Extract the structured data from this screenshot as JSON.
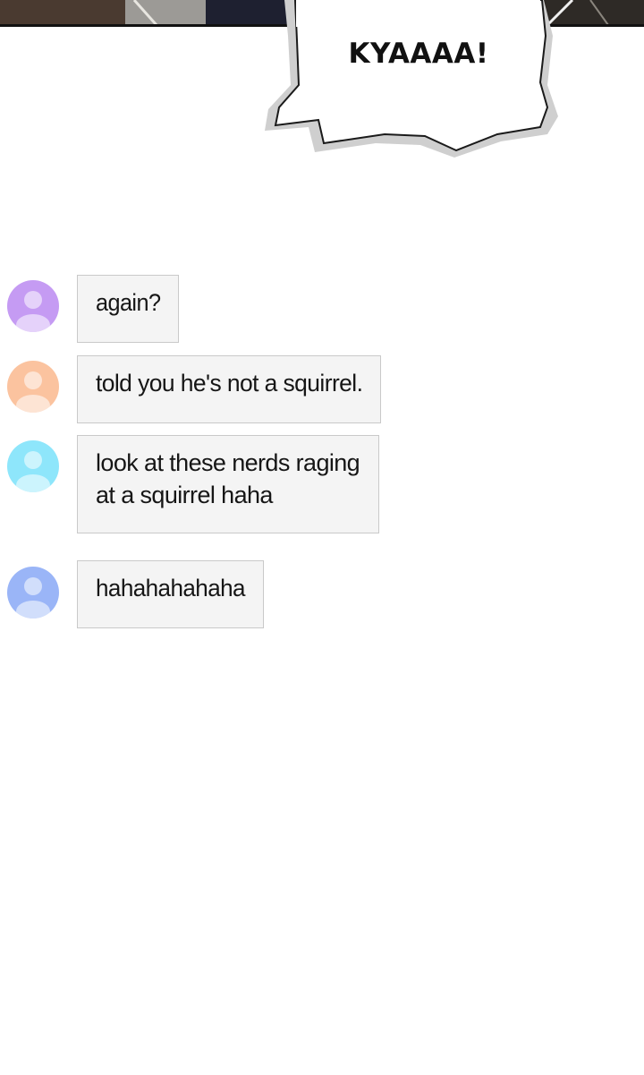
{
  "comic": {
    "shout": "KYAAAA!"
  },
  "chat": {
    "messages": [
      {
        "avatar_color": "#c59bf3",
        "lines": [
          "again?"
        ]
      },
      {
        "avatar_color": "#fbc39f",
        "lines": [
          "told you he's not a squirrel."
        ]
      },
      {
        "avatar_color": "#8ee6fb",
        "lines": [
          "look at these nerds raging",
          "at a squirrel haha"
        ]
      },
      {
        "avatar_color": "#9ab5f7",
        "lines": [
          "hahahahahaha"
        ]
      }
    ]
  }
}
